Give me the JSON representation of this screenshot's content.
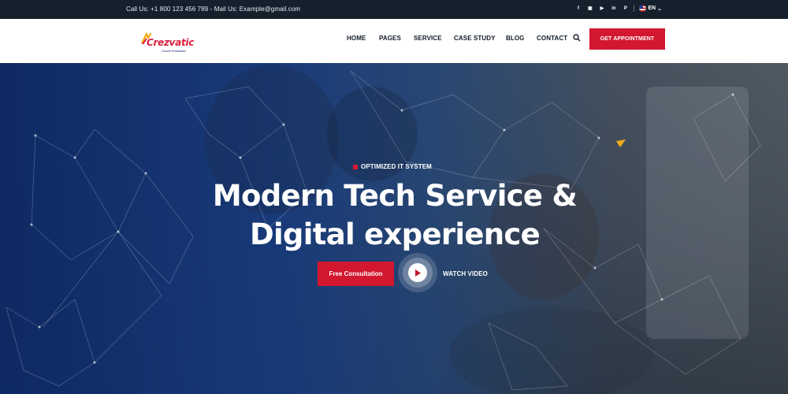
{
  "topbar": {
    "contact_text": "Call Us: +1 800 123 456 789 - Mail Us: Example@gmail.com",
    "language": "EN",
    "social_icons": [
      "facebook-icon",
      "linkedin-icon",
      "youtube-icon",
      "linkedin-icon",
      "pinterest-icon"
    ]
  },
  "header": {
    "logo_text": "Crezvatic",
    "logo_tagline": "Growth Realization",
    "nav": [
      "HOME",
      "PAGES",
      "SERVICE",
      "CASE STUDY",
      "BLOG",
      "CONTACT"
    ],
    "cta_label": "GET APPOINTMENT"
  },
  "hero": {
    "eyebrow": "OPTIMIZED IT SYSTEM",
    "title_line1": "Modern Tech Service &",
    "title_line2": "Digital experience",
    "primary_button": "Free Consultation",
    "secondary_button": "WATCH VIDEO"
  },
  "colors": {
    "accent": "#d2172f",
    "topbar": "#14202c",
    "hero_blue": "#17397a",
    "text_dark": "#121b26"
  }
}
